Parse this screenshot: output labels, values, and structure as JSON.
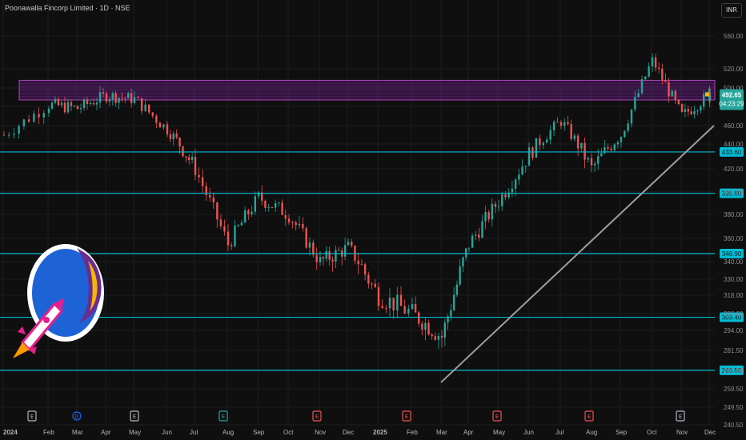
{
  "header": {
    "symbol_title": "Poonawalla Fincorp Limited · 1D · NSE",
    "currency_button": "INR"
  },
  "colors": {
    "background": "#0f0f0f",
    "bull": "#26a69a",
    "bear": "#ef5350",
    "level_line": "#00bcd4",
    "zone_fill": "#7b1fa2",
    "zone_border": "#ab47bc",
    "trendline": "#9e9e9e",
    "price_tag": "#26a69a",
    "logo_blue": "#1e63d6",
    "logo_yellow": "#f5b700",
    "logo_purple": "#6a2c91",
    "logo_pink": "#e91e8c"
  },
  "chart_data": {
    "type": "candlestick",
    "y_axis_ticks": [
      "560.00",
      "520.00",
      "500.00",
      "480.00",
      "460.00",
      "440.00",
      "420.00",
      "400.00",
      "380.00",
      "360.00",
      "340.00",
      "330.00",
      "318.00",
      "306.00",
      "294.00",
      "281.50",
      "269.50",
      "259.50",
      "249.50",
      "240.50"
    ],
    "x_axis_ticks": [
      "2024",
      "Feb",
      "Mar",
      "Apr",
      "May",
      "Jun",
      "Jul",
      "Aug",
      "Sep",
      "Oct",
      "Nov",
      "Dec",
      "2025",
      "Feb",
      "Mar",
      "Apr",
      "May",
      "Jun",
      "Jul",
      "Aug",
      "Sep",
      "Oct",
      "Nov",
      "Dec"
    ],
    "horizontal_levels": [
      {
        "value": 433.6,
        "label": "433.60"
      },
      {
        "value": 398.8,
        "label": "398.80"
      },
      {
        "value": 346.9,
        "label": "346.90"
      },
      {
        "value": 303.4,
        "label": "303.40"
      },
      {
        "value": 269.55,
        "label": "269.55"
      }
    ],
    "resistance_zone": {
      "from": 487,
      "to": 508,
      "start": "2024-01",
      "end": "2025-12"
    },
    "trendline": {
      "start_date": "2025-03",
      "start_value": 263,
      "end_date": "2025-12",
      "end_value": 460
    },
    "current_price": {
      "value": 492.65,
      "label": "492.65",
      "countdown": "04:23:29"
    },
    "closes_monthly": [
      {
        "month": "Jan 2024",
        "close": 450
      },
      {
        "month": "Feb 2024",
        "close": 482
      },
      {
        "month": "Mar 2024",
        "close": 478
      },
      {
        "month": "Apr 2024",
        "close": 492
      },
      {
        "month": "May 2024",
        "close": 488
      },
      {
        "month": "Jun 2024",
        "close": 456
      },
      {
        "month": "Jul 2024",
        "close": 420
      },
      {
        "month": "Aug 2024",
        "close": 355
      },
      {
        "month": "Sep 2024",
        "close": 395
      },
      {
        "month": "Oct 2024",
        "close": 380
      },
      {
        "month": "Nov 2024",
        "close": 340
      },
      {
        "month": "Dec 2024",
        "close": 352
      },
      {
        "month": "Jan 2025",
        "close": 318
      },
      {
        "month": "Feb 2025",
        "close": 306
      },
      {
        "month": "Mar 2025",
        "close": 290
      },
      {
        "month": "Apr 2025",
        "close": 355
      },
      {
        "month": "May 2025",
        "close": 392
      },
      {
        "month": "Jun 2025",
        "close": 432
      },
      {
        "month": "Jul 2025",
        "close": 465
      },
      {
        "month": "Aug 2025",
        "close": 420
      },
      {
        "month": "Sep 2025",
        "close": 450
      },
      {
        "month": "Oct 2025",
        "close": 530
      },
      {
        "month": "Nov 2025",
        "close": 470
      },
      {
        "month": "Dec 2025",
        "close": 492.65
      }
    ],
    "event_markers": [
      {
        "date": "2024-01",
        "letter": "E",
        "color": "#b2b5be"
      },
      {
        "date": "2024-02",
        "letter": "D",
        "color": "#2962ff"
      },
      {
        "date": "2024-04",
        "letter": "E",
        "color": "#b2b5be"
      },
      {
        "date": "2024-07",
        "letter": "E",
        "color": "#26a69a"
      },
      {
        "date": "2024-10",
        "letter": "E",
        "color": "#ef5350"
      },
      {
        "date": "2025-01",
        "letter": "E",
        "color": "#ef5350"
      },
      {
        "date": "2025-04",
        "letter": "E",
        "color": "#ef5350"
      },
      {
        "date": "2025-07",
        "letter": "E",
        "color": "#ef5350"
      },
      {
        "date": "2025-10",
        "letter": "E",
        "color": "#b2b5be"
      }
    ]
  }
}
